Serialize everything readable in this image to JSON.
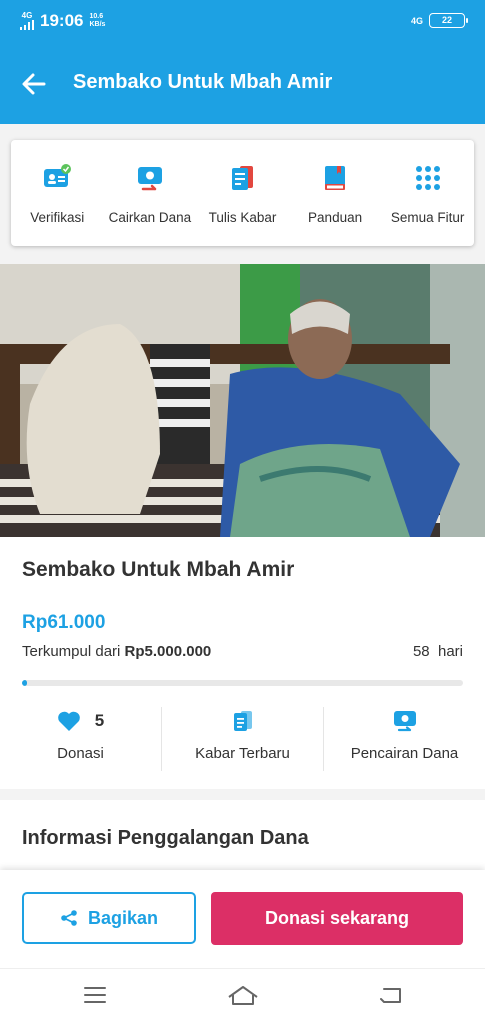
{
  "status_bar": {
    "network": "4G",
    "time": "19:06",
    "speed_value": "10.6",
    "speed_unit": "KB/s",
    "network_right": "4G",
    "battery": "22"
  },
  "app_bar": {
    "title": "Sembako Untuk Mbah Amir"
  },
  "features": [
    {
      "label": "Verifikasi",
      "icon": "verification-icon"
    },
    {
      "label": "Cairkan Dana",
      "icon": "withdraw-funds-icon"
    },
    {
      "label": "Tulis Kabar",
      "icon": "write-news-icon"
    },
    {
      "label": "Panduan",
      "icon": "guide-book-icon"
    },
    {
      "label": "Semua Fitur",
      "icon": "all-features-grid-icon"
    }
  ],
  "campaign": {
    "title": "Sembako Untuk Mbah Amir",
    "collected": "Rp61.000",
    "target_prefix": "Terkumpul dari",
    "target": "Rp5.000.000",
    "days_left": "58",
    "days_unit": "hari",
    "progress_percent": 1.2
  },
  "stats": [
    {
      "value": "5",
      "label": "Donasi",
      "icon": "heart-icon"
    },
    {
      "label": "Kabar Terbaru",
      "icon": "news-icon"
    },
    {
      "label": "Pencairan Dana",
      "icon": "withdrawal-icon"
    }
  ],
  "info": {
    "title": "Informasi Penggalangan Dana"
  },
  "actions": {
    "share_label": "Bagikan",
    "donate_label": "Donasi sekarang"
  },
  "colors": {
    "primary": "#1da1e3",
    "donate": "#dc2f66"
  }
}
